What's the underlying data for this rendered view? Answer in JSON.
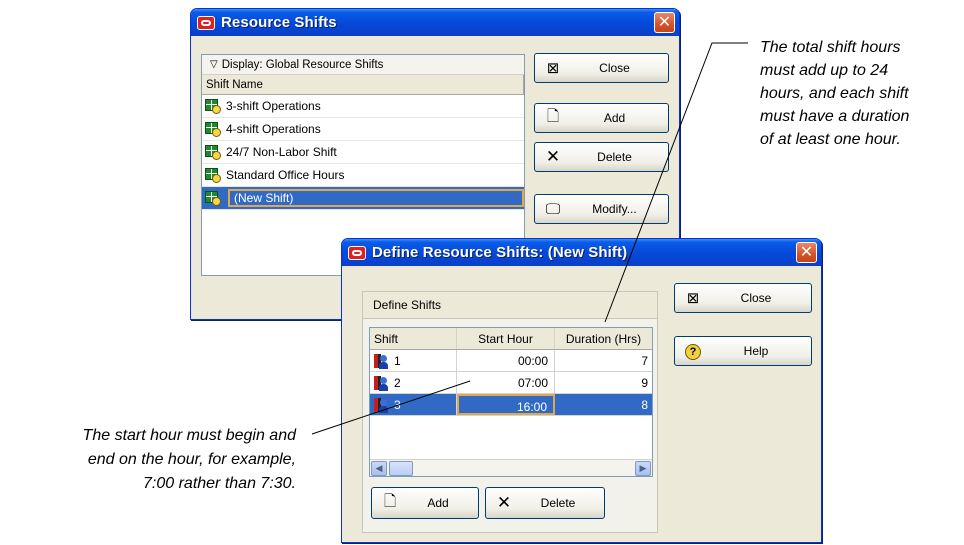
{
  "resource_shifts": {
    "title": "Resource Shifts",
    "display_label": "Display: Global Resource Shifts",
    "column_header": "Shift Name",
    "items": [
      {
        "label": "3-shift Operations"
      },
      {
        "label": "4-shift Operations"
      },
      {
        "label": "24/7 Non-Labor Shift"
      },
      {
        "label": "Standard Office Hours"
      },
      {
        "label": "(New Shift)",
        "selected": true
      }
    ],
    "buttons": {
      "close": "Close",
      "add": "Add",
      "delete": "Delete",
      "modify": "Modify..."
    }
  },
  "define_shifts": {
    "title": "Define Resource Shifts: (New Shift)",
    "group_label": "Define Shifts",
    "columns": [
      "Shift",
      "Start Hour",
      "Duration (Hrs)"
    ],
    "rows": [
      {
        "shift": "1",
        "start_hour": "00:00",
        "duration": "7"
      },
      {
        "shift": "2",
        "start_hour": "07:00",
        "duration": "9"
      },
      {
        "shift": "3",
        "start_hour": "16:00",
        "duration": "8",
        "selected": true
      }
    ],
    "buttons": {
      "close": "Close",
      "help": "Help",
      "add": "Add",
      "delete": "Delete"
    }
  },
  "annotations": {
    "top_right": [
      "The total shift hours",
      "must add up to 24",
      "hours, and each shift",
      "must have a duration",
      "of at least one hour."
    ],
    "bottom_left": [
      "The start hour must begin and",
      "end on the hour, for example,",
      "7:00 rather than 7:30."
    ]
  },
  "colors": {
    "title_bar": "#0a5ce6",
    "selection": "#316ac5",
    "focus_border": "#e0a84a",
    "close_button": "#d2542a"
  }
}
